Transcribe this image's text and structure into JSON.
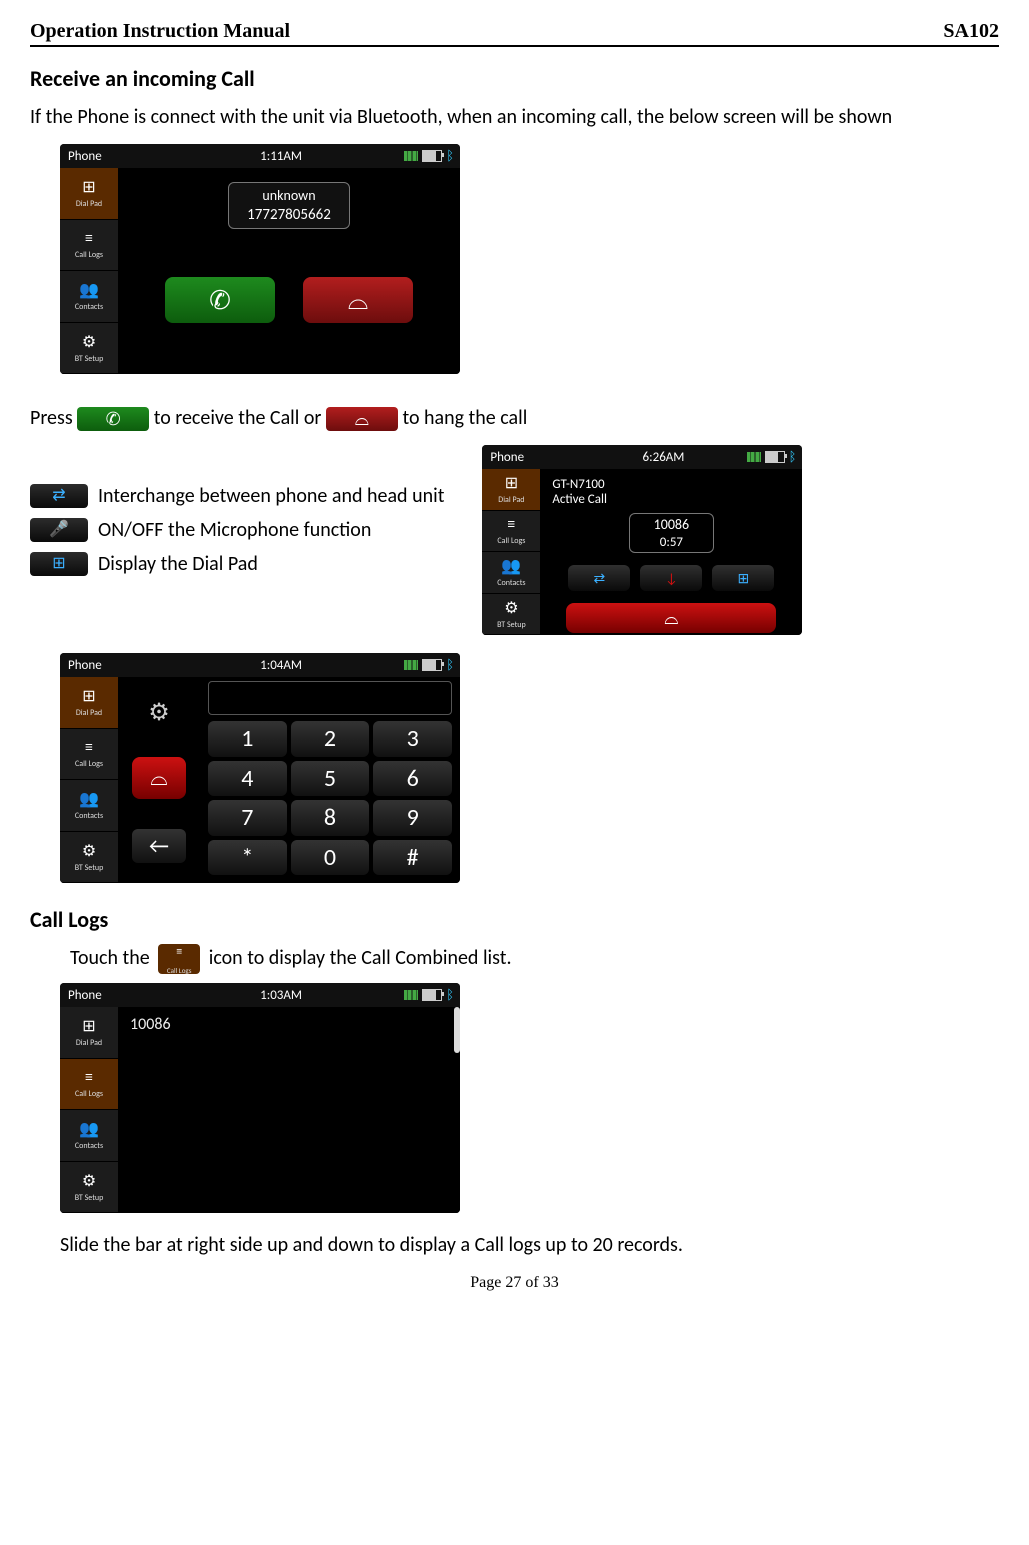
{
  "header": {
    "left": "Operation Instruction Manual",
    "right": "SA102"
  },
  "sections": {
    "receive_title": "Receive an incoming Call",
    "receive_text": "If the Phone is connect with the unit via Bluetooth, when an incoming call, the below screen will be shown",
    "press_pre": "Press ",
    "press_mid": " to receive the Call or ",
    "press_post": " to hang the call",
    "legend": {
      "interchange": "Interchange between phone and head unit",
      "mic": "ON/OFF the Microphone function",
      "dialpad": "Display the Dial Pad"
    },
    "calllogs_title": "Call Logs",
    "touch_pre": "Touch the ",
    "touch_post": " icon to display the Call Combined list.",
    "slide_text": "Slide the bar at right side up and down to display a Call logs up to 20 records."
  },
  "sidebar": {
    "items": [
      {
        "label": "Dial Pad",
        "icon": "⊞"
      },
      {
        "label": "Call Logs",
        "icon": "≡"
      },
      {
        "label": "Contacts",
        "icon": "👥"
      },
      {
        "label": "BT Setup",
        "icon": "⚙"
      }
    ]
  },
  "shot1": {
    "app": "Phone",
    "time": "1:11AM",
    "caller_name": "unknown",
    "caller_num": "17727805662",
    "active_sidebar_index": 0
  },
  "shot2": {
    "app": "Phone",
    "time": "6:26AM",
    "device_name": "GT-N7100",
    "status": "Active Call",
    "num": "10086",
    "duration": "0:57",
    "active_sidebar_index": 0
  },
  "shot3": {
    "app": "Phone",
    "time": "1:04AM",
    "keys": [
      "1",
      "2",
      "3",
      "4",
      "5",
      "6",
      "7",
      "8",
      "9",
      "*",
      "0",
      "#"
    ],
    "back_key": "←",
    "active_sidebar_index": 0
  },
  "shot4": {
    "app": "Phone",
    "time": "1:03AM",
    "log_entry": "10086",
    "active_sidebar_index": 1
  },
  "calllogs_tab_label": "Call Logs",
  "footer": "Page 27 of 33"
}
